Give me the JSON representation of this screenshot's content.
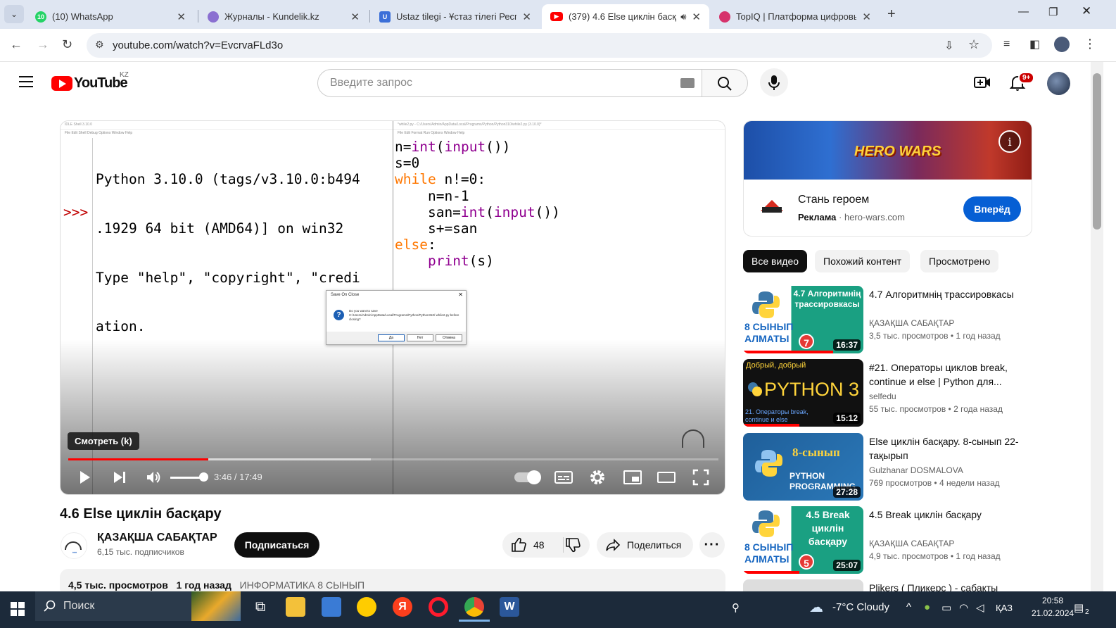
{
  "browser": {
    "tabs": [
      {
        "title": "(10) WhatsApp",
        "favicon": "whatsapp-icon",
        "color": "#25d366"
      },
      {
        "title": "Журналы - Kundelik.kz",
        "favicon": "kundelik-icon",
        "color": "#8a6fd1"
      },
      {
        "title": "Ustaz tilegi - Ұстаз тілегі Респу",
        "favicon": "ustaz-icon",
        "color": "#3b6fd8"
      },
      {
        "title": "(379) 4.6 Else циклін басқа",
        "favicon": "youtube-icon",
        "color": "#ff0000"
      },
      {
        "title": "TopIQ | Платформа цифровых",
        "favicon": "topiq-icon",
        "color": "#d6336c"
      }
    ],
    "url": "youtube.com/watch?v=EvcrvaFLd3o"
  },
  "youtube": {
    "country_code": "KZ",
    "logo_text": "YouTube",
    "search_placeholder": "Введите запрос",
    "notification_count": "9+"
  },
  "player": {
    "shell_lines": [
      "Python 3.10.0 (tags/v3.10.0:b494",
      ".1929 64 bit (AMD64)] on win32",
      "Type \"help\", \"copyright\", \"credi",
      "ation."
    ],
    "shell_prompt": ">>>",
    "shell_title": "IDLE Shell 3.10.0",
    "shell_menu": "File   Edit   Shell   Debug   Options   Window   Help",
    "editor_title": "*while2.py - C:/Users/Admin/AppData/Local/Programs/Python/Python310/while2.py (3.10.0)*",
    "editor_menu": "File   Edit   Format   Run   Options   Window   Help",
    "dialog_title": "Save On Close",
    "dialog_message": "Do you want to save C:/Users/Admin/AppData/Local/Programs/Python/Python310/ while2.py before closing?",
    "dialog_buttons": [
      "Да",
      "Нет",
      "Отмена"
    ],
    "watch_later_tooltip": "Смотреть (k)",
    "current_time": "3:46",
    "duration": "17:49",
    "progress_fraction": 0.215
  },
  "video": {
    "title": "4.6 Else циклін басқару",
    "channel": "ҚАЗАҚША САБАҚТАР",
    "subscribers": "6,15 тыс. подписчиков",
    "subscribe_label": "Подписаться",
    "likes": "48",
    "share_label": "Поделиться",
    "views": "4,5 тыс. просмотров",
    "published": "1 год назад",
    "tag": "ИНФОРМАТИКА 8 СЫНЫП"
  },
  "ad": {
    "brand": "HERO WARS",
    "title": "Стань героем",
    "label": "Реклама",
    "domain": "hero-wars.com",
    "cta": "Вперёд"
  },
  "chips": [
    "Все видео",
    "Похожий контент",
    "Просмотрено"
  ],
  "recommendations": [
    {
      "title": "4.7 Алгоритмнің трассировкасы",
      "channel": "ҚАЗАҚША САБАҚТАР",
      "views": "3,5 тыс. просмотров",
      "age": "1 год назад",
      "duration": "16:37",
      "thumb_text": "4.7 Алгоритмнің трассировкасы",
      "thumb_sub": "8 СЫНЫП АЛМАТЫ",
      "watched": 0.75
    },
    {
      "title": "#21. Операторы циклов break, continue и else | Python для...",
      "channel": "selfedu",
      "views": "55 тыс. просмотров",
      "age": "2 года назад",
      "duration": "15:12",
      "thumb_text": "PYTHON 3",
      "thumb_sub": "Добрый, добрый",
      "thumb_note": "21. Операторы break, continue и else",
      "watched": 0.47
    },
    {
      "title": "Else циклін басқару. 8-сынып 22- тақырып",
      "channel": "Gulzhanar DOSMALOVA",
      "views": "769 просмотров",
      "age": "4 недели назад",
      "duration": "27:28",
      "thumb_text": "8-сынып",
      "thumb_sub": "PYTHON PROGRAMMING",
      "watched": 0
    },
    {
      "title": "4.5 Break циклін басқару",
      "channel": "ҚАЗАҚША САБАҚТАР",
      "views": "4,9 тыс. просмотров",
      "age": "1 год назад",
      "duration": "25:07",
      "thumb_text": "4.5 Break циклін басқару",
      "thumb_sub": "8 СЫНЫП АЛМАТЫ",
      "watched": 0.47
    },
    {
      "title": "Plikers ( Пликерс ) - сабақты",
      "channel": "",
      "views": "",
      "age": "",
      "duration": "",
      "thumb_text": "",
      "thumb_sub": "",
      "watched": 0
    }
  ],
  "taskbar": {
    "search_placeholder": "Поиск",
    "weather": "-7°C  Cloudy",
    "language": "ҚАЗ",
    "time": "20:58",
    "date": "21.02.2024",
    "notifications": "2"
  }
}
